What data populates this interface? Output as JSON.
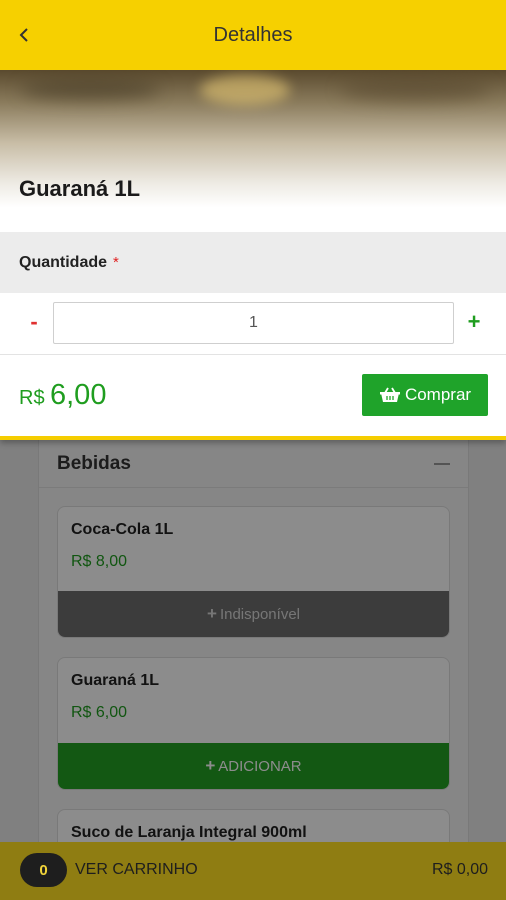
{
  "header": {
    "title": "Detalhes",
    "back_icon": "chevron-left-icon"
  },
  "product": {
    "title": "Guaraná 1L"
  },
  "quantity": {
    "label": "Quantidade",
    "required_mark": "*",
    "minus": "-",
    "plus": "+",
    "value": "1"
  },
  "price": {
    "currency": "R$",
    "value": "6,00"
  },
  "buy_button": {
    "icon": "basket-icon",
    "label": "Comprar"
  },
  "category": {
    "title": "Bebidas",
    "items": [
      {
        "name": "Coca-Cola 1L",
        "price": "R$ 8,00",
        "button": "Indisponível",
        "status": "unavailable"
      },
      {
        "name": "Guaraná 1L",
        "price": "R$ 6,00",
        "button": "ADICIONAR",
        "status": "available"
      },
      {
        "name": "Suco de Laranja Integral 900ml"
      }
    ]
  },
  "cart": {
    "count": "0",
    "label": "VER CARRINHO",
    "total": "R$ 0,00"
  },
  "colors": {
    "brand_yellow": "#f6d000",
    "accent_green": "#1fa32a",
    "required_red": "#e02020"
  }
}
